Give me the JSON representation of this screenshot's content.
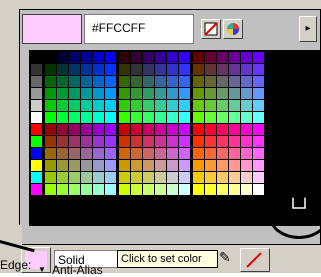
{
  "picker": {
    "hex_value": "#FFCCFF",
    "preview_color": "#ffccff",
    "scroll_label": "▸"
  },
  "toolbar": {
    "style_value": "Solid",
    "tooltip": "Click to set color",
    "edge_label": "Edge:",
    "edge_value": "Anti-Alias",
    "stroke_swatch_color": "#ffccff"
  },
  "icons": {
    "no_color": "no-color-icon",
    "wheel": "color-wheel-icon",
    "pencil": "pencil-icon",
    "stroke": "stroke-icon"
  }
}
